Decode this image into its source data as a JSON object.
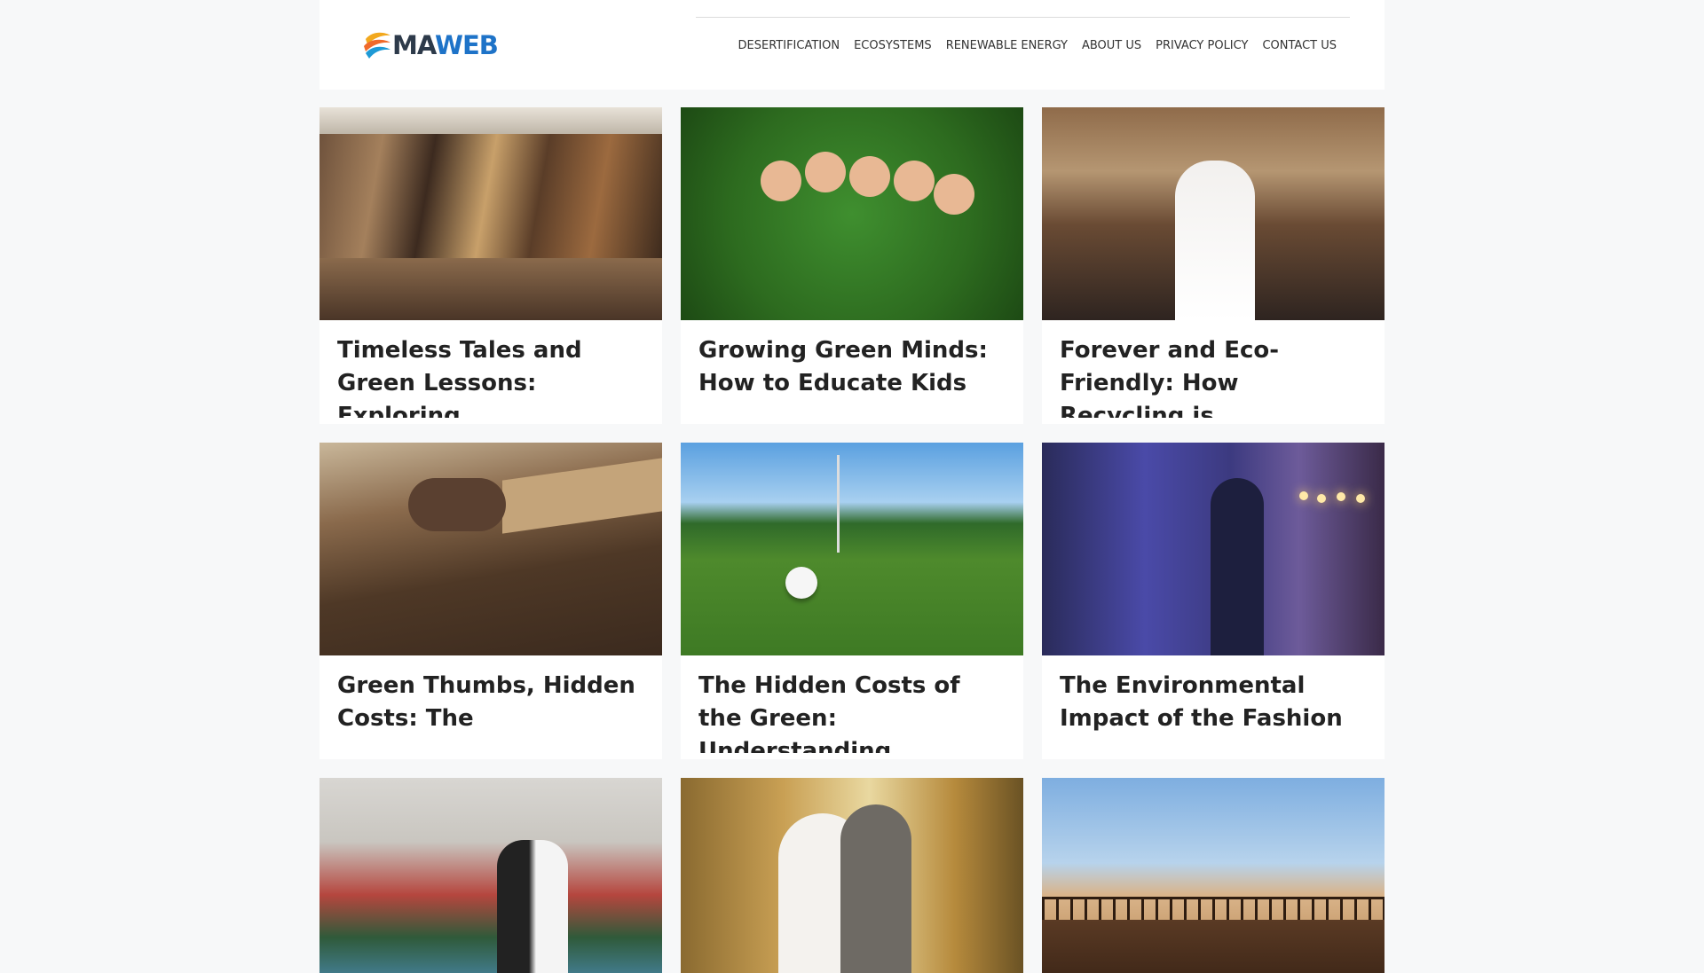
{
  "header": {
    "logo_prefix": "MA",
    "logo_suffix": "WEB"
  },
  "nav": {
    "items": [
      {
        "label": "DESERTIFICATION"
      },
      {
        "label": "ECOSYSTEMS"
      },
      {
        "label": "RENEWABLE ENERGY"
      },
      {
        "label": "ABOUT US"
      },
      {
        "label": "PRIVACY POLICY"
      },
      {
        "label": "CONTACT US"
      }
    ]
  },
  "colors": {
    "page_background": "#f7f8f9",
    "card_background": "#ffffff",
    "logo_accent": "#1e73c8"
  },
  "posts": [
    {
      "title": "Timeless Tales and Green Lessons: Exploring"
    },
    {
      "title": "Growing Green Minds: How to Educate Kids"
    },
    {
      "title": "Forever and Eco-Friendly: How Recycling is"
    },
    {
      "title": "Green Thumbs, Hidden Costs: The"
    },
    {
      "title": "The Hidden Costs of the Green: Understanding"
    },
    {
      "title": "The Environmental Impact of the Fashion"
    }
  ]
}
